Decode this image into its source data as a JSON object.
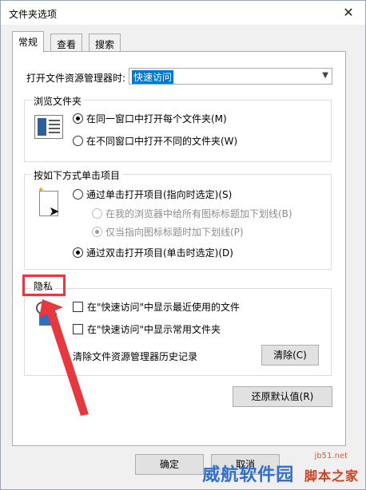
{
  "window": {
    "title": "文件夹选项",
    "close_glyph": "✕"
  },
  "tabs": [
    {
      "label": "常规",
      "active": true
    },
    {
      "label": "查看",
      "active": false
    },
    {
      "label": "搜索",
      "active": false
    }
  ],
  "open_explorer": {
    "label": "打开文件资源管理器时:",
    "value": "快速访问"
  },
  "browse_group": {
    "legend": "浏览文件夹",
    "option_same": "在同一窗口中打开每个文件夹(M)",
    "option_new": "在不同窗口中打开不同的文件夹(W)"
  },
  "click_group": {
    "legend": "按如下方式单击项目",
    "single": "通过单击打开项目(指向时选定)(S)",
    "underline_all": "在我的浏览器中给所有图标标题加下划线(B)",
    "underline_hover": "仅当指向图标标题时加下划线(P)",
    "double": "通过双击打开项目(单击时选定)(D)"
  },
  "privacy_group": {
    "legend": "隐私",
    "recent_files": "在\"快速访问\"中显示最近使用的文件",
    "frequent_folders": "在\"快速访问\"中显示常用文件夹",
    "clear_history_label": "清除文件资源管理器历史记录",
    "clear_button": "清除(C)"
  },
  "restore_button": "还原默认值(R)",
  "footer": {
    "ok": "确定",
    "cancel": "取消"
  },
  "watermark": {
    "text": "威航软件园",
    "sub": "jb51.net",
    "overlay": "脚本之家"
  },
  "colors": {
    "annotation_red": "#e8383d",
    "selection_blue": "#0078d7"
  }
}
